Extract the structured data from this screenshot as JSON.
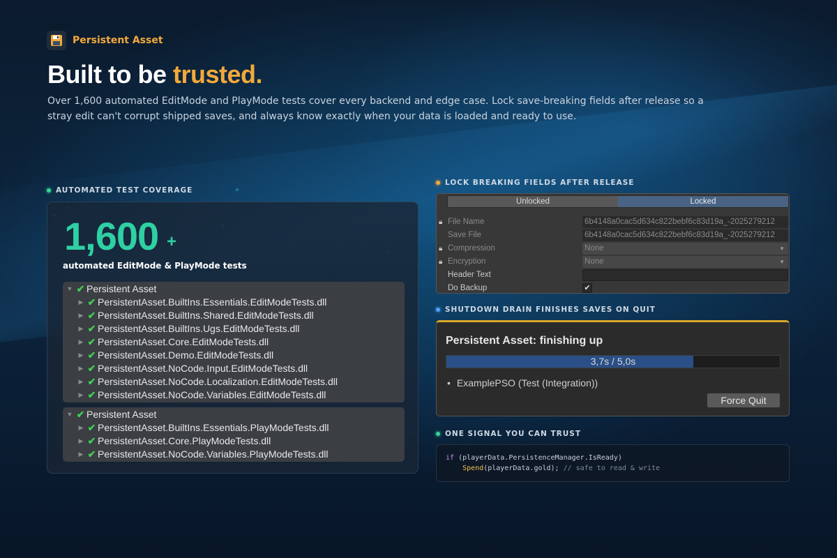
{
  "brand": {
    "name": "Persistent Asset",
    "icon": "floppy-disk-icon",
    "accent": "#f2a93b"
  },
  "headline": {
    "prefix": "Built to be ",
    "accent": "trusted."
  },
  "intro": "Over 1,600 automated EditMode and PlayMode tests cover every backend and edge case. Lock save-breaking fields after release so a stray edit can't corrupt shipped saves, and always know exactly when your data is loaded and ready to use.",
  "sections": {
    "coverage": "AUTOMATED TEST COVERAGE",
    "lock": "LOCK BREAKING FIELDS AFTER RELEASE",
    "shutdown": "SHUTDOWN DRAIN FINISHES SAVES ON QUIT",
    "signal": "ONE SIGNAL YOU CAN TRUST"
  },
  "coverage": {
    "count": "1,600",
    "plus": "+",
    "caption": "automated EditMode & PlayMode tests",
    "editmode_tree": {
      "root": "Persistent Asset",
      "items": [
        "PersistentAsset.BuiltIns.Essentials.EditModeTests.dll",
        "PersistentAsset.BuiltIns.Shared.EditModeTests.dll",
        "PersistentAsset.BuiltIns.Ugs.EditModeTests.dll",
        "PersistentAsset.Core.EditModeTests.dll",
        "PersistentAsset.Demo.EditModeTests.dll",
        "PersistentAsset.NoCode.Input.EditModeTests.dll",
        "PersistentAsset.NoCode.Localization.EditModeTests.dll",
        "PersistentAsset.NoCode.Variables.EditModeTests.dll"
      ]
    },
    "playmode_tree": {
      "root": "Persistent Asset",
      "items": [
        "PersistentAsset.BuiltIns.Essentials.PlayModeTests.dll",
        "PersistentAsset.Core.PlayModeTests.dll",
        "PersistentAsset.NoCode.Variables.PlayModeTests.dll"
      ]
    }
  },
  "lock_panel": {
    "tabs": {
      "unlocked": "Unlocked",
      "locked": "Locked"
    },
    "fields": [
      {
        "label": "File Name",
        "value": "6b4148a0cac5d634c822bebf6c83d19a_-2025279212",
        "locked": true
      },
      {
        "label": "Save File",
        "value": "6b4148a0cac5d634c822bebf6c83d19a_-2025279212",
        "locked": false
      },
      {
        "label": "Compression",
        "value": "None",
        "locked": true
      },
      {
        "label": "Encryption",
        "value": "None",
        "locked": true
      },
      {
        "label": "Header Text",
        "value": ""
      },
      {
        "label": "Do Backup",
        "value": "✔"
      }
    ]
  },
  "shutdown_dialog": {
    "title": "Persistent Asset: finishing up",
    "progress_text": "3,7s / 5,0s",
    "progress_fraction": 0.74,
    "item": "ExamplePSO  (Test (Integration))",
    "button": "Force Quit"
  },
  "code": {
    "line1_kw": "if",
    "line1_rest": " (playerData.PersistenceManager.IsReady)",
    "line2_fn": "Spend",
    "line2_rest": "(playerData.gold); ",
    "line2_comment": "// safe to read & write"
  }
}
